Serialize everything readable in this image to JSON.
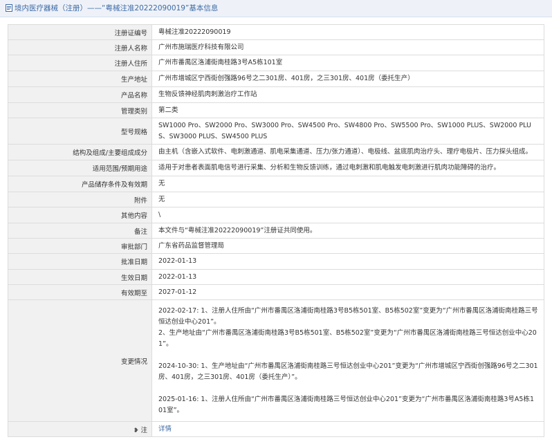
{
  "header": {
    "title": "境内医疗器械（注册）——“粤械注准20222090019”基本信息"
  },
  "rows": [
    {
      "label": "注册证编号",
      "value": "粤械注准20222090019"
    },
    {
      "label": "注册人名称",
      "value": "广州市施瑞医疗科技有限公司"
    },
    {
      "label": "注册人住所",
      "value": "广州市番禺区洛浦街南桂路3号A5栋101室"
    },
    {
      "label": "生产地址",
      "value": "广州市增城区宁西街创强路96号之二301房、401房，之三301房、401房（委托生产）"
    },
    {
      "label": "产品名称",
      "value": "生物反馈神经肌肉刺激治疗工作站"
    },
    {
      "label": "管理类别",
      "value": "第二类"
    },
    {
      "label": "型号规格",
      "value": "SW1000 Pro、SW2000 Pro、SW3000 Pro、SW4500 Pro、SW4800 Pro、SW5500 Pro、SW1000 PLUS、SW2000 PLUS、SW3000 PLUS、SW4500 PLUS"
    },
    {
      "label": "结构及组成/主要组成成分",
      "value": "由主机（含嵌入式软件、电刺激通道、肌电采集通道、压力/张力通道）、电极线、盆底肌肉治疗头、理疗电极片、压力探头组成。"
    },
    {
      "label": "适用范围/预期用途",
      "value": "适用于对患者表面肌电信号进行采集、分析和生物反馈训练，通过电刺激和肌电触发电刺激进行肌肉功能障碍的治疗。"
    },
    {
      "label": "产品储存条件及有效期",
      "value": "无"
    },
    {
      "label": "附件",
      "value": "无"
    },
    {
      "label": "其他内容",
      "value": "\\"
    },
    {
      "label": "备注",
      "value": "本文件与“粤械注准20222090019”注册证共同使用。"
    },
    {
      "label": "审批部门",
      "value": "广东省药品监督管理局"
    },
    {
      "label": "批准日期",
      "value": "2022-01-13"
    },
    {
      "label": "生效日期",
      "value": "2022-01-13"
    },
    {
      "label": "有效期至",
      "value": "2027-01-12"
    }
  ],
  "changes": {
    "label": "变更情况",
    "blocks": [
      "2022-02-17: 1、注册人住所由“广州市番禺区洛浦街南桂路3号B5栋501室、B5栋502室”变更为“广州市番禺区洛浦街南桂路三号恒达创业中心201”。\n2、生产地址由“广州市番禺区洛浦街南桂路3号B5栋501室、B5栋502室”变更为“广州市番禺区洛浦街南桂路三号恒达创业中心201”。",
      "2024-10-30: 1、生产地址由“广州市番禺区洛浦街南桂路三号恒达创业中心201”变更为“广州市增城区宁西街创强路96号之二301房、401房，之三301房、401房（委托生产）”。",
      "2025-01-16: 1、注册人住所由“广州市番禺区洛浦街南桂路三号恒达创业中心201”变更为“广州市番禺区洛浦街南桂路3号A5栋101室”。"
    ]
  },
  "note": {
    "label": "注",
    "link_text": "详情"
  }
}
